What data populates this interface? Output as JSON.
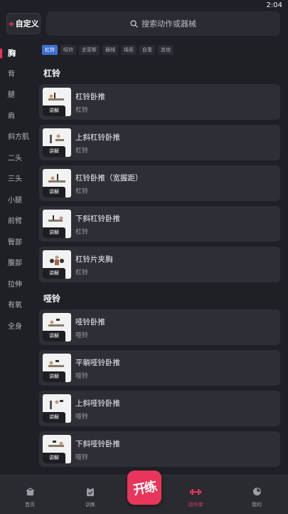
{
  "status": {
    "time": "2:04"
  },
  "header": {
    "custom_plus": "+",
    "custom_label": "自定义",
    "search_placeholder": "搜索动作或器械"
  },
  "sidebar": {
    "items": [
      {
        "label": "胸",
        "active": true
      },
      {
        "label": "背"
      },
      {
        "label": "腿"
      },
      {
        "label": "肩"
      },
      {
        "label": "斜方肌"
      },
      {
        "label": "二头"
      },
      {
        "label": "三头"
      },
      {
        "label": "小腿"
      },
      {
        "label": "前臂"
      },
      {
        "label": "臀部"
      },
      {
        "label": "腹部"
      },
      {
        "label": "拉伸"
      },
      {
        "label": "有氧"
      },
      {
        "label": "全身"
      }
    ]
  },
  "filters": [
    "杠铃",
    "哑铃",
    "史密斯",
    "器械",
    "绳索",
    "自重",
    "其他"
  ],
  "sections": [
    {
      "title": "杠铃",
      "items": [
        {
          "name": "杠铃卧推",
          "equipment": "杠铃",
          "badge": "讲解"
        },
        {
          "name": "上斜杠铃卧推",
          "equipment": "杠铃",
          "badge": "讲解"
        },
        {
          "name": "杠铃卧推（宽握距）",
          "equipment": "杠铃",
          "badge": "讲解"
        },
        {
          "name": "下斜杠铃卧推",
          "equipment": "杠铃",
          "badge": "讲解"
        },
        {
          "name": "杠铃片夹胸",
          "equipment": "杠铃",
          "badge": "讲解"
        }
      ]
    },
    {
      "title": "哑铃",
      "items": [
        {
          "name": "哑铃卧推",
          "equipment": "哑铃",
          "badge": "讲解"
        },
        {
          "name": "平躺哑铃卧推",
          "equipment": "哑铃",
          "badge": "讲解"
        },
        {
          "name": "上斜哑铃卧推",
          "equipment": "哑铃",
          "badge": "讲解"
        },
        {
          "name": "下斜哑铃卧推",
          "equipment": "哑铃",
          "badge": "讲解"
        }
      ]
    }
  ],
  "tabbar": {
    "home": "首页",
    "train": "训练",
    "logo": "开练",
    "library": "动作库",
    "mine": "我的"
  },
  "colors": {
    "accent": "#e8355a",
    "chip_active": "#3d6fd0",
    "background": "#1f2026"
  }
}
